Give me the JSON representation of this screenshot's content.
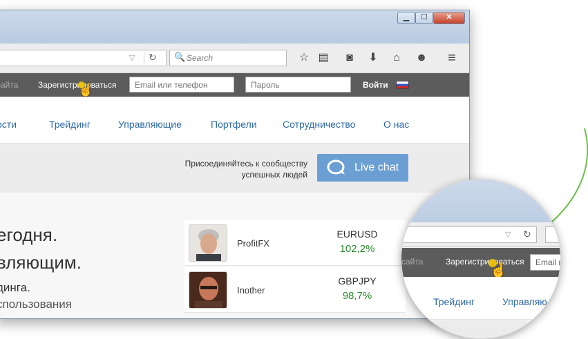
{
  "browser": {
    "window_controls": {
      "minimize": "▁",
      "maximize": "☐",
      "close": "✕"
    },
    "search_placeholder": "Search",
    "url_dropdown": "▽",
    "reload_glyph": "↻",
    "toolbar_icons": [
      "star-icon",
      "reading-list-icon",
      "pocket-icon",
      "download-icon",
      "home-icon",
      "chat-bubble-icon",
      "menu-icon"
    ],
    "toolbar_glyphs": {
      "search": "🔍",
      "star": "☆",
      "reading_list": "▤",
      "pocket": "◙",
      "download": "⬇",
      "home": "⌂",
      "chat": "☻",
      "menu": "≡"
    }
  },
  "topbar": {
    "site_text": "сайта",
    "register_label": "Зарегистрироваться",
    "email_placeholder": "Email или телефон",
    "password_placeholder": "Пароль",
    "login_label": "Войти",
    "flag": "ru-flag-icon",
    "cursor": "☝"
  },
  "nav": {
    "items": [
      "ости",
      "Трейдинг",
      "Управляющие",
      "Портфели",
      "Сотрудничество",
      "О нас"
    ]
  },
  "join": {
    "line1": "Присоединяйтесь к сообществу",
    "line2": "успешных людей",
    "livechat_label": "Live chat",
    "accent_color": "#6b9fd4"
  },
  "hero": {
    "line1": "егодня.",
    "line2": "вляющим.",
    "line3": "динга.",
    "line4": "спользования"
  },
  "managers": [
    {
      "name": "ProfitFX",
      "pair": "EURUSD",
      "return": "102,2%"
    },
    {
      "name": "Inother",
      "pair": "GBPJPY",
      "return": "98,7%"
    }
  ],
  "magnifier": {
    "site_text": "сайта",
    "register_label": "Зарегистрироваться",
    "email_placeholder": "Email и",
    "nav_items": [
      "Трейдинг",
      "Управляю"
    ],
    "cursor": "☝"
  },
  "colors": {
    "return_green": "#2b8a2b",
    "topbar_bg": "#5c5c5c",
    "link_blue": "#2e6aa6",
    "arc_green": "#6cc04a",
    "cursor_dot": "#f2c300"
  }
}
